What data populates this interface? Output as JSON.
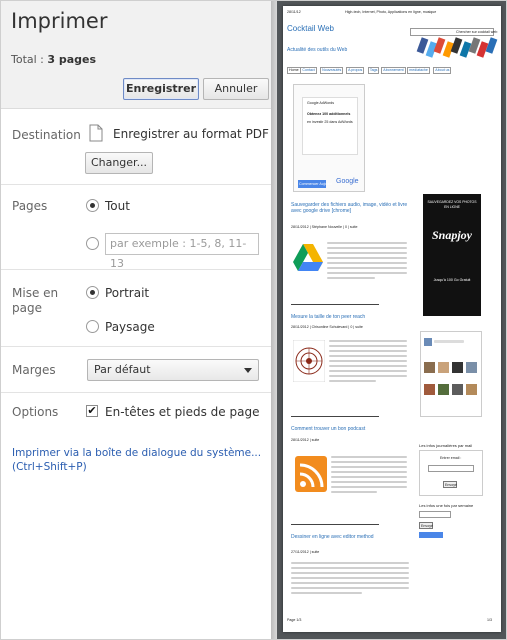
{
  "dialog": {
    "title": "Imprimer",
    "total_label": "Total :",
    "total_value": "3 pages",
    "save_button": "Enregistrer",
    "cancel_button": "Annuler"
  },
  "destination": {
    "label": "Destination",
    "value": "Enregistrer au format PDF",
    "change_button": "Changer..."
  },
  "pages": {
    "label": "Pages",
    "option_all": "Tout",
    "input_placeholder": "par exemple : 1-5, 8, 11-13"
  },
  "layout": {
    "label": "Mise en page",
    "portrait": "Portrait",
    "landscape": "Paysage"
  },
  "margins": {
    "label": "Marges",
    "selected": "Par défaut"
  },
  "options": {
    "label": "Options",
    "headers_footers": "En-têtes et pieds de page"
  },
  "system_dialog_link": "Imprimer via la boîte de dialogue du système... (Ctrl+Shift+P)",
  "preview": {
    "header_date": "28/11/12",
    "header_title": "High-tech, Internet, Photo, Applications en ligne, musique",
    "site_title": "Cocktail Web",
    "site_subtitle": "Actualité des outils du Web",
    "search_label": "Chercher sur cocktail web",
    "nav": [
      "Home",
      "Contact",
      "Nouveautés",
      "A propos",
      "Tags",
      "Abonnement",
      "mediatache",
      "About us"
    ],
    "ad_title": "Google AdWords",
    "ad_offer": "Obtenez 100 additionnels",
    "ad_sub": "en investir 25 dans AdWords",
    "ad_button": "Commencer Aujourd",
    "ad_logo": "Google",
    "snapjoy_top": "SAUVEGARDEZ VOS PHOTOS EN LIGNE",
    "snapjoy_logo": "Snapjoy",
    "snapjoy_bottom": "Jusqu'à 100 Go Gratuit",
    "posts": [
      {
        "title": "Sauvegarder des fichiers audio, image, vidéo et livre avec google drive [chrome]",
        "meta": "28/11/2012 | Stéphane Nouvelle | 0 | suite"
      },
      {
        "title": "Mesure la taille de ton peer reach",
        "meta": "28/11/2012 | Chisonline Schulevard | 0 | suite"
      },
      {
        "title": "Comment trouver un bon podcast",
        "meta": "28/11/2012 | suite"
      },
      {
        "title": "Dessiner en ligne avec editor method",
        "meta": "27/11/2012 | suite"
      }
    ],
    "sidebar_headings": [
      "Les infos journalières par mail",
      "Les infos une fois par semaine"
    ],
    "sidebar_email_label": "Entrer email :",
    "sidebar_button": "Envoyé",
    "footer_left": "Page 1/3",
    "footer_right": "1/3"
  }
}
